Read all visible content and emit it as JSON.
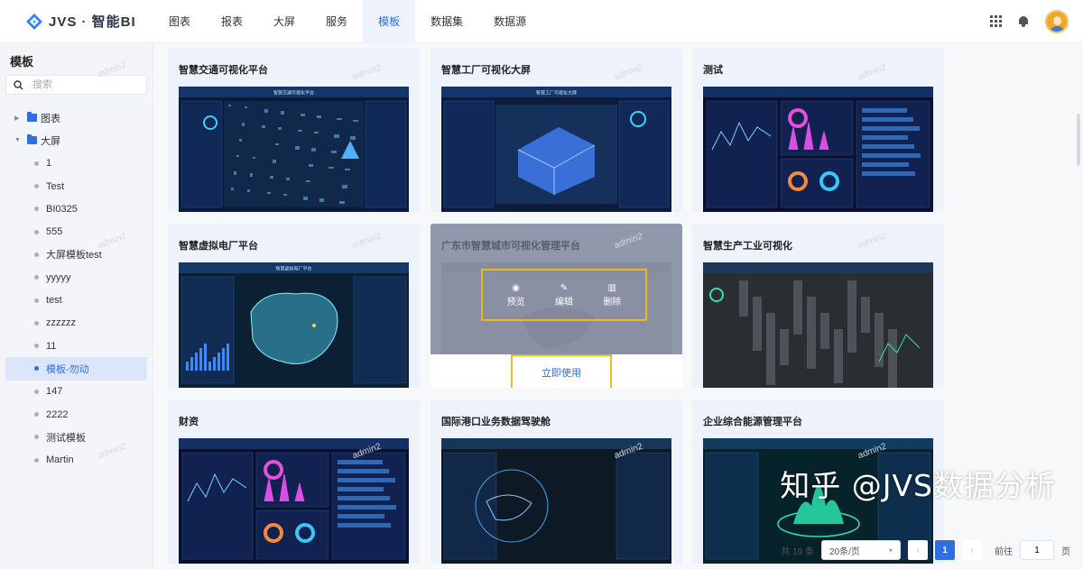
{
  "app": {
    "name": "JVS · 智能BI"
  },
  "nav": [
    {
      "label": "图表",
      "active": false
    },
    {
      "label": "报表",
      "active": false
    },
    {
      "label": "大屏",
      "active": false
    },
    {
      "label": "服务",
      "active": false
    },
    {
      "label": "模板",
      "active": true
    },
    {
      "label": "数据集",
      "active": false
    },
    {
      "label": "数据源",
      "active": false
    }
  ],
  "header_icons": [
    "apps-grid-icon",
    "bell-icon",
    "user-avatar"
  ],
  "sidebar": {
    "title": "模板",
    "search_placeholder": "搜索",
    "tree": [
      {
        "label": "图表",
        "type": "folder",
        "expanded": false
      },
      {
        "label": "大屏",
        "type": "folder",
        "expanded": true
      },
      {
        "label": "1",
        "type": "leaf"
      },
      {
        "label": "Test",
        "type": "leaf"
      },
      {
        "label": "BI0325",
        "type": "leaf"
      },
      {
        "label": "555",
        "type": "leaf"
      },
      {
        "label": "大屏模板test",
        "type": "leaf"
      },
      {
        "label": "yyyyy",
        "type": "leaf"
      },
      {
        "label": "test",
        "type": "leaf"
      },
      {
        "label": "zzzzzz",
        "type": "leaf"
      },
      {
        "label": "11",
        "type": "leaf"
      },
      {
        "label": "模板-勿动",
        "type": "leaf",
        "selected": true
      },
      {
        "label": "147",
        "type": "leaf"
      },
      {
        "label": "2222",
        "type": "leaf"
      },
      {
        "label": "测试模板",
        "type": "leaf"
      },
      {
        "label": "Martin",
        "type": "leaf"
      }
    ]
  },
  "watermark_user": "admin2",
  "cards": [
    {
      "title": "智慧交通可视化平台",
      "thumb_title": "智慧交通可视化平台",
      "theme": "traffic"
    },
    {
      "title": "智慧工厂可视化大屏",
      "thumb_title": "智慧工厂可视化大屏",
      "theme": "factory"
    },
    {
      "title": "测试",
      "theme": "dashboard"
    },
    {
      "title": "智慧虚拟电厂平台",
      "thumb_title": "智慧虚拟电厂平台",
      "theme": "map"
    },
    {
      "title": "广东市智慧城市可视化管理平台",
      "theme": "city",
      "hovered": true
    },
    {
      "title": "智慧生产工业可视化",
      "theme": "industry"
    },
    {
      "title": "财资",
      "theme": "dashboard"
    },
    {
      "title": "国际港口业务数据驾驶舱",
      "theme": "port"
    },
    {
      "title": "企业综合能源管理平台",
      "theme": "energy"
    }
  ],
  "hover_actions": {
    "preview": "预览",
    "edit": "编辑",
    "delete": "删除",
    "use": "立即使用"
  },
  "pagination": {
    "total_text": "共 19 条",
    "page_size": "20条/页",
    "current_page": "1",
    "goto_label": "前往",
    "goto_value": "1",
    "page_suffix": "页"
  },
  "watermark": "知乎 @JVS数据分析",
  "colors": {
    "accent": "#2f6fe4",
    "highlight_border": "#f2b71c"
  }
}
